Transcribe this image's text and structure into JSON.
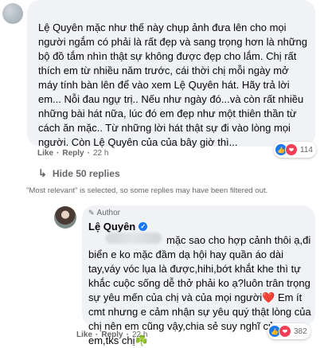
{
  "comment": {
    "text": "Lệ Quyên mặc như thế này chụp ảnh đưa lên cho mọi người ngắm có phải là rất đẹp và sang trọng hơn là những bộ đồ tắm nhìn thật sự không được đẹp cho lắm. Chị rất thích em từ nhiều năm trước, cái thời chị mỗi ngày mở máy tính bàn lên để vào xem Lệ Quyên hát. Hãy trả lời em... Nỗi đau ngự trị.. Nếu như ngày đó...và còn rất nhiều những bài hát nữa, lúc đó em đẹp như một thiên thần từ cách ăn mặc.. Từ những lời hát thật sự đi vào lòng mọi người. Còn Lệ Quyên của của bây giờ thì...",
    "like_label": "Like",
    "reply_label": "Reply",
    "time": "22 h",
    "reaction_count": "114"
  },
  "hide_replies_label": "Hide 50 replies",
  "filter_note": "\"Most relevant\" is selected, so some replies may have been filtered out.",
  "reply": {
    "author_badge": "Author",
    "name": "Lệ Quyên",
    "text": "mặc sao cho hợp cảnh thôi ạ,đi biển e ko mặc đầm dạ hội hay quần áo dài tay,váy vóc lụa là được,hihi,bớt khắt khe thì tự khắc cuộc sống dễ thở phải ko ạ?luôn trân trọng sự yêu mến của chị và của mọi người",
    "text_tail": " Em ít cmt nhưng e cảm nhận sự yêu quý thật lòng của chị nên em cũng vậy,chia sẻ suy nghĩ của em,tks chị",
    "like_label": "Like",
    "reply_label": "Reply",
    "time": "22 h",
    "reaction_count": "382"
  },
  "icons": {
    "heart": "heart-emoji",
    "shamrock": "shamrock-emoji",
    "like": "like-reaction-icon",
    "love": "love-reaction-icon",
    "pen": "pen-icon",
    "verified": "verified-badge-icon",
    "arrow": "reply-arrow-icon"
  },
  "colors": {
    "bubble": "#f0f2f5",
    "meta_text": "#65676b",
    "like_blue": "#1877f2",
    "love_red": "#f33e58"
  }
}
